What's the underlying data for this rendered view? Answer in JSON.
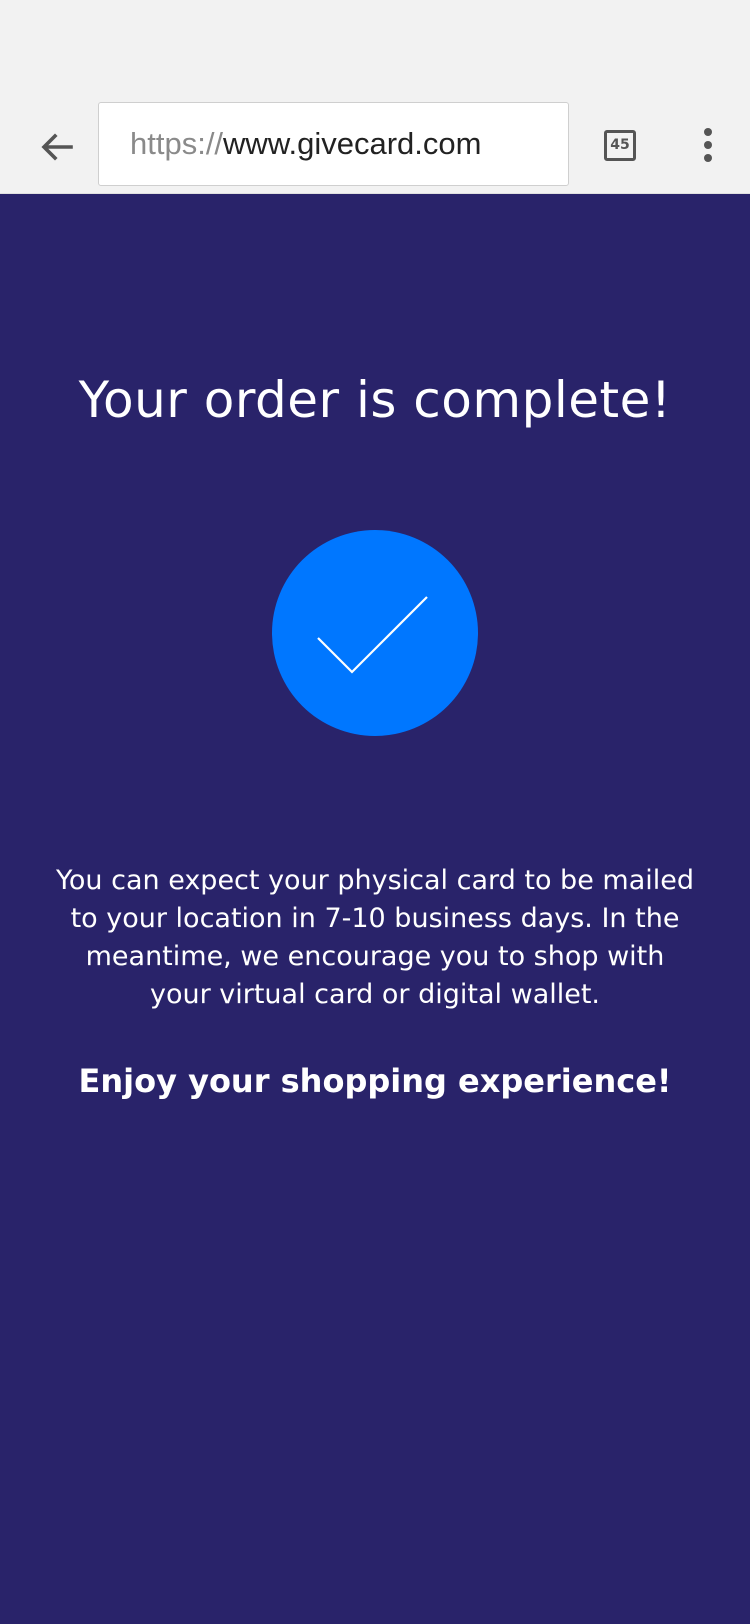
{
  "browser": {
    "url_scheme": "https://",
    "url_host": "www.givecard.com",
    "tab_count": "45",
    "icons": {
      "back": "arrow-back-icon",
      "tabs": "tabs-icon",
      "menu": "more-vert-icon"
    }
  },
  "page": {
    "title": "Your order is complete!",
    "message": "You can expect your physical card to be mailed to your location in 7-10 business days. In the meantime, we encourage you to shop with your virtual card or digital wallet.",
    "closing": "Enjoy your shopping experience!",
    "status_icon": "checkmark-icon"
  },
  "colors": {
    "background": "#29236a",
    "accent": "#0077ff",
    "toolbar": "#f2f2f2",
    "text": "#ffffff"
  }
}
